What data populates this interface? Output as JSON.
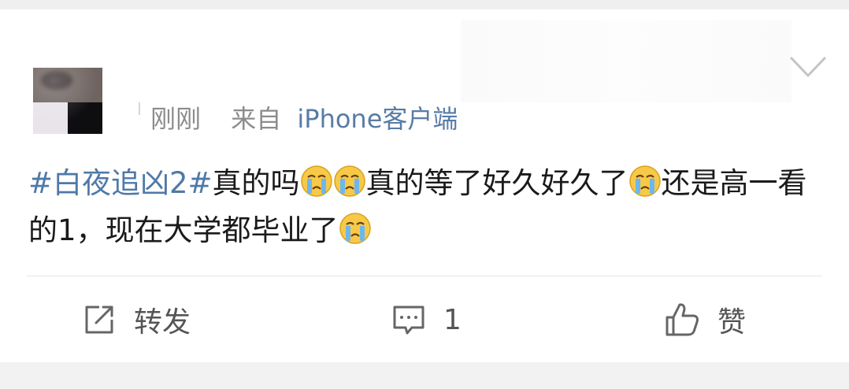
{
  "post": {
    "time": "刚刚",
    "from_prefix": "来自",
    "source": "iPhone客户端",
    "content": {
      "hashtag": "#白夜追凶2#",
      "segment_1": "真的吗",
      "segment_2": "真的等了好久好久了",
      "segment_3": "还是高一看的1，现在大学都毕业了"
    },
    "emoji_name": "crying-face-emoji"
  },
  "actions": {
    "repost_label": "转发",
    "comment_count": "1",
    "like_label": "赞"
  },
  "colors": {
    "link": "#4f79a8",
    "source": "#587ca6",
    "meta": "#8c8c8c",
    "action_text": "#555555"
  }
}
